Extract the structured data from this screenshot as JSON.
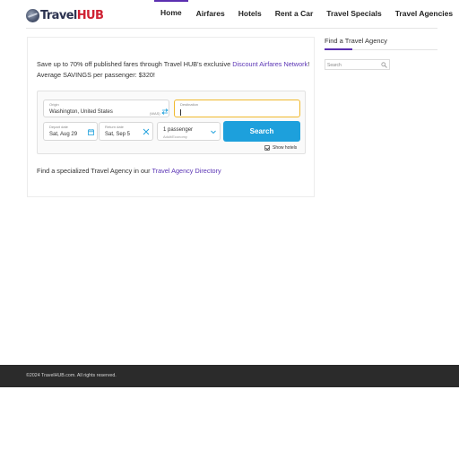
{
  "brand": {
    "name_prefix": "Travel",
    "name_suffix": "HUB"
  },
  "nav": {
    "items": [
      {
        "label": "Home",
        "active": true
      },
      {
        "label": "Airfares",
        "active": false
      },
      {
        "label": "Hotels",
        "active": false
      },
      {
        "label": "Rent a Car",
        "active": false
      },
      {
        "label": "Travel Specials",
        "active": false
      },
      {
        "label": "Travel Agencies",
        "active": false
      }
    ]
  },
  "main": {
    "promo_text_1": "Save up to 70% off published fares through Travel HUB's exclusive ",
    "promo_link": "Discount Airfares Network",
    "promo_text_2": "! Average SAVINGS per passenger: $320!",
    "directory_text": "Find a specialized Travel Agency in our ",
    "directory_link": "Travel Agency Directory"
  },
  "search_widget": {
    "origin": {
      "label": "Origin",
      "value": "Washington, United States",
      "code": "(WAS)"
    },
    "destination": {
      "label": "Destination",
      "value": ""
    },
    "depart": {
      "label": "Depart date",
      "value": "Sat, Aug 29"
    },
    "return": {
      "label": "Return date",
      "value": "Sat, Sep 5"
    },
    "passengers": {
      "value": "1 passenger",
      "sub": "Adult/Economy"
    },
    "search_label": "Search",
    "show_hotels_label": "Show hotels",
    "show_hotels_checked": true,
    "accent_color": "#1da0dc",
    "focus_color": "#f0b92e"
  },
  "sidebar": {
    "title": "Find a Travel Agency",
    "search_placeholder": "Search"
  },
  "footer": {
    "copyright": "©2024 TravelHUB.com. All rights reserved."
  },
  "colors": {
    "brand_purple": "#5b2fb0",
    "brand_red": "#cf2233",
    "footer_bg": "#2b2b2b"
  }
}
